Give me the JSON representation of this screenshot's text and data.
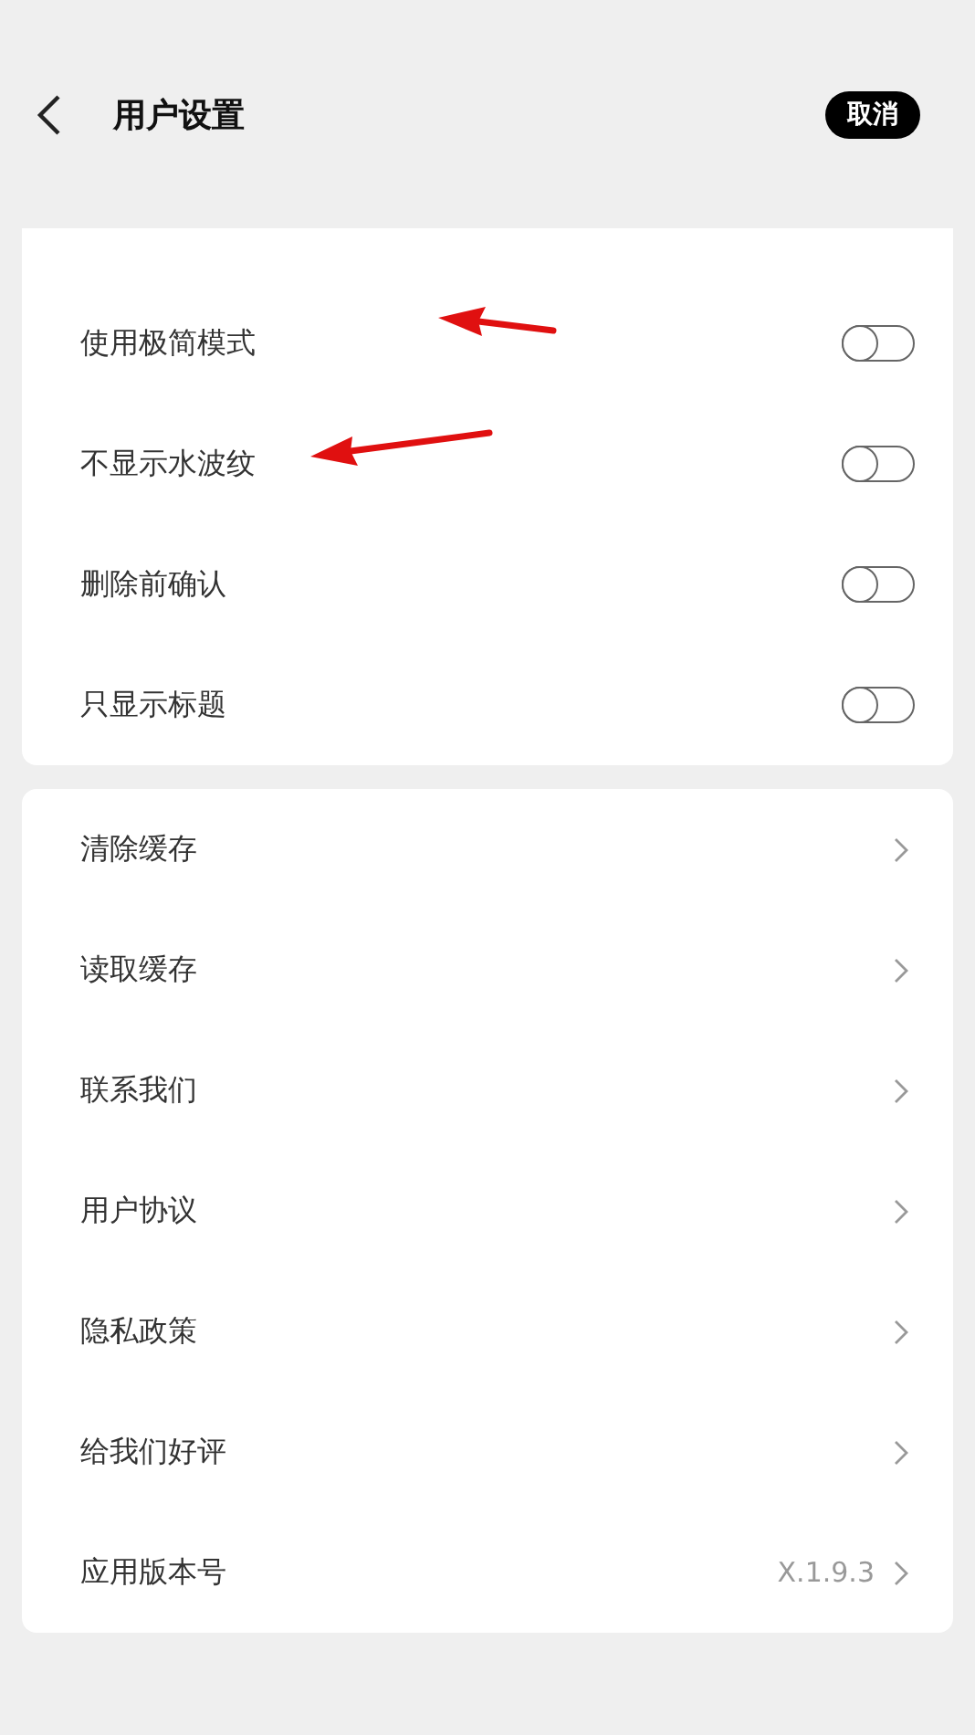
{
  "header": {
    "title": "用户设置",
    "cancel_button": "取消"
  },
  "toggle_settings": [
    {
      "label": "使用极简模式",
      "on": false
    },
    {
      "label": "不显示水波纹",
      "on": false
    },
    {
      "label": "删除前确认",
      "on": false
    },
    {
      "label": "只显示标题",
      "on": false
    }
  ],
  "menu_items": [
    {
      "label": "清除缓存"
    },
    {
      "label": "读取缓存"
    },
    {
      "label": "联系我们"
    },
    {
      "label": "用户协议"
    },
    {
      "label": "隐私政策"
    },
    {
      "label": "给我们好评"
    },
    {
      "label": "应用版本号",
      "value": "X.1.9.3"
    }
  ]
}
